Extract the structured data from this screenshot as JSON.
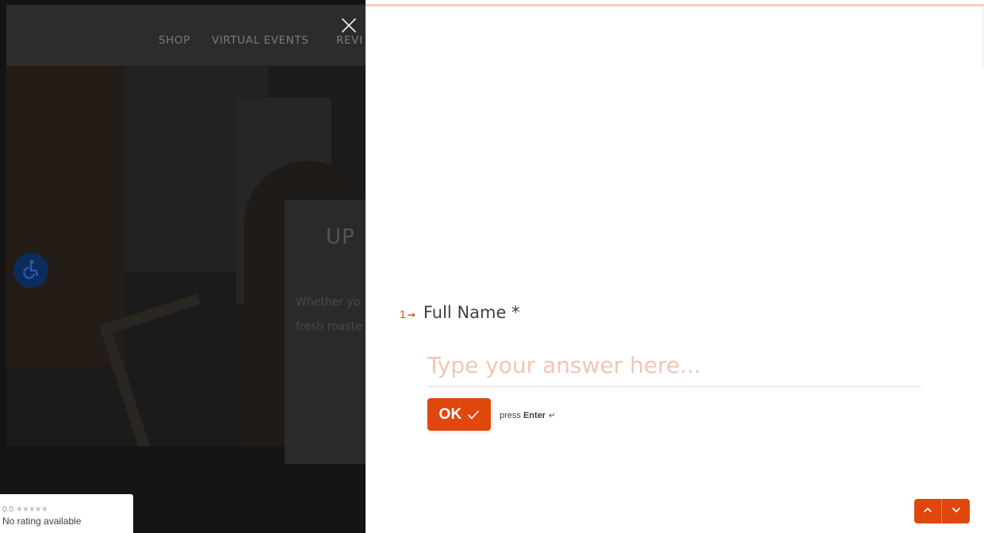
{
  "background_site": {
    "nav": {
      "shop": "SHOP",
      "virtual_events": "VIRTUAL EVENTS",
      "reviews_partial": "REVI"
    },
    "hero_card": {
      "title_partial": "UP",
      "line1_partial": "Whether yo",
      "line2_partial": "fresh roaste"
    },
    "rating_widget": {
      "score": "0.0",
      "stars": "★★★★★",
      "status": "No rating available"
    }
  },
  "form": {
    "question_number": "1",
    "question_arrow": "→",
    "question_label": "Full Name *",
    "answer_placeholder": "Type your answer here...",
    "answer_value": "",
    "ok_label": "OK",
    "hint_prefix": "press ",
    "hint_key": "Enter",
    "hint_symbol": "↵"
  },
  "colors": {
    "accent": "#e0470d",
    "placeholder": "#f3c5b2",
    "progress": "#f4d0bf",
    "overlay": "#141414"
  },
  "icons": {
    "close": "close-icon",
    "check": "check-icon",
    "accessibility": "accessibility-icon",
    "up": "chevron-up-icon",
    "down": "chevron-down-icon"
  }
}
